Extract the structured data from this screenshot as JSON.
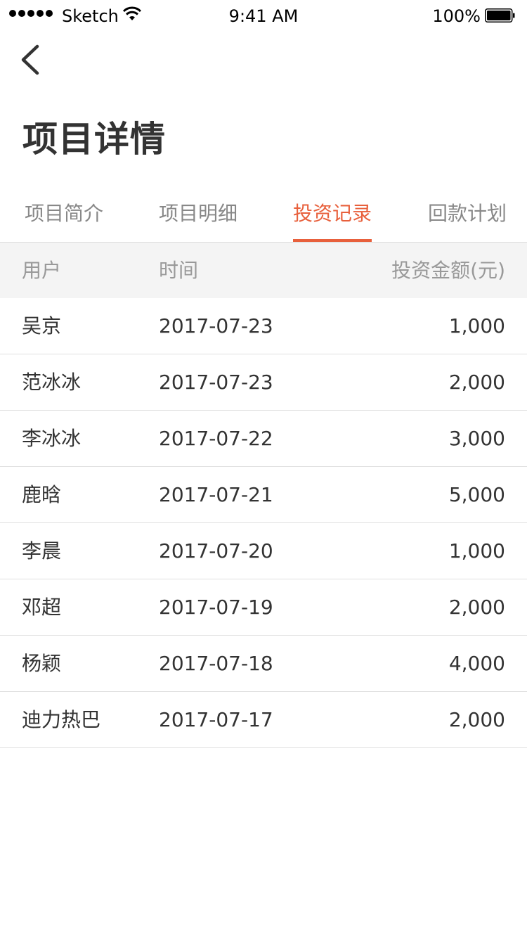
{
  "status_bar": {
    "carrier": "Sketch",
    "time": "9:41 AM",
    "battery_percent": "100%"
  },
  "nav": {
    "back_icon": "chevron-left-icon"
  },
  "page": {
    "title": "项目详情"
  },
  "tabs": [
    {
      "label": "项目简介",
      "active": false
    },
    {
      "label": "项目明细",
      "active": false
    },
    {
      "label": "投资记录",
      "active": true
    },
    {
      "label": "回款计划",
      "active": false
    }
  ],
  "accent_color": "#e8603c",
  "table": {
    "headers": {
      "user": "用户",
      "time": "时间",
      "amount": "投资金额(元)"
    },
    "rows": [
      {
        "user": "吴京",
        "time": "2017-07-23",
        "amount": "1,000"
      },
      {
        "user": "范冰冰",
        "time": "2017-07-23",
        "amount": "2,000"
      },
      {
        "user": "李冰冰",
        "time": "2017-07-22",
        "amount": "3,000"
      },
      {
        "user": "鹿晗",
        "time": "2017-07-21",
        "amount": "5,000"
      },
      {
        "user": "李晨",
        "time": "2017-07-20",
        "amount": "1,000"
      },
      {
        "user": "邓超",
        "time": "2017-07-19",
        "amount": "2,000"
      },
      {
        "user": "杨颖",
        "time": "2017-07-18",
        "amount": "4,000"
      },
      {
        "user": "迪力热巴",
        "time": "2017-07-17",
        "amount": "2,000"
      }
    ]
  }
}
